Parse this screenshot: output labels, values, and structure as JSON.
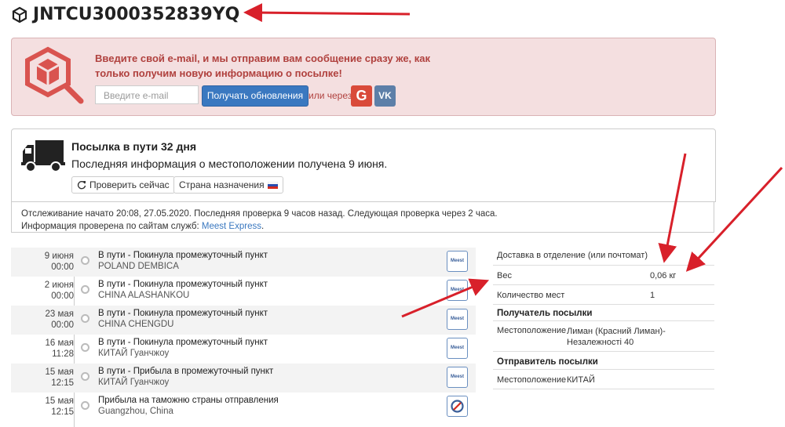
{
  "tracking_number": "JNTCU3000352839YQ",
  "subscribe": {
    "message": "Введите свой e-mail, и мы отправим вам сообщение сразу же, как только получим новую информацию о посылке!",
    "email_placeholder": "Введите e-mail",
    "button_label": "Получать обновления",
    "via_label": "или через",
    "google_label": "G",
    "vk_label": "VK"
  },
  "status": {
    "title": "Посылка в пути 32 дня",
    "subtitle": "Последняя информация о местоположении получена 9 июня.",
    "check_now_label": "Проверить сейчас",
    "destination_label": "Страна назначения"
  },
  "tracking_info": {
    "line1": "Отслеживание начато 20:08, 27.05.2020. Последняя проверка 9 часов назад. Следующая проверка через 2 часа.",
    "line2_prefix": "Информация проверена по сайтам служб:",
    "service_link": "Meest Express",
    "line2_suffix": "."
  },
  "events": [
    {
      "date": "9 июня",
      "time": "00:00",
      "title": "В пути - Покинула промежуточный пункт",
      "location": "POLAND DEMBICA",
      "service_icon": "meest-icon"
    },
    {
      "date": "2 июня",
      "time": "00:00",
      "title": "В пути - Покинула промежуточный пункт",
      "location": "CHINA ALASHANKOU",
      "service_icon": "meest-icon"
    },
    {
      "date": "23 мая",
      "time": "00:00",
      "title": "В пути - Покинула промежуточный пункт",
      "location": "CHINA CHENGDU",
      "service_icon": "meest-icon"
    },
    {
      "date": "16 мая",
      "time": "11:28",
      "title": "В пути - Покинула промежуточный пункт",
      "location": "КИТАЙ Гуанчжоу",
      "service_icon": "meest-icon"
    },
    {
      "date": "15 мая",
      "time": "12:15",
      "title": "В пути - Прибыла в промежуточный пункт",
      "location": "КИТАЙ Гуанчжоу",
      "service_icon": "meest-icon"
    },
    {
      "date": "15 мая",
      "time": "12:15",
      "title": "Прибыла на таможню страны отправления",
      "location": "Guangzhou, China",
      "service_icon": "customs-icon"
    }
  ],
  "details": {
    "delivery_type": "Доставка в отделение (или почтомат)",
    "weight_label": "Вес",
    "weight_value": "0,06 кг",
    "pieces_label": "Количество мест",
    "pieces_value": "1",
    "recipient_heading": "Получатель посылки",
    "recipient_location_label": "Местоположение",
    "recipient_location_value": "Лиман (Красний Лиман)-Незалежності 40",
    "sender_heading": "Отправитель посылки",
    "sender_location_label": "Местоположение",
    "sender_location_value": "КИТАЙ"
  },
  "service_icon_text": "Meest",
  "colors": {
    "alert_bg": "#f4dfe0",
    "alert_text": "#b0413e",
    "primary_button": "#3a78c0",
    "google": "#d94a3a",
    "vk": "#5d7fa8",
    "annotation_arrow": "#d8202a"
  }
}
